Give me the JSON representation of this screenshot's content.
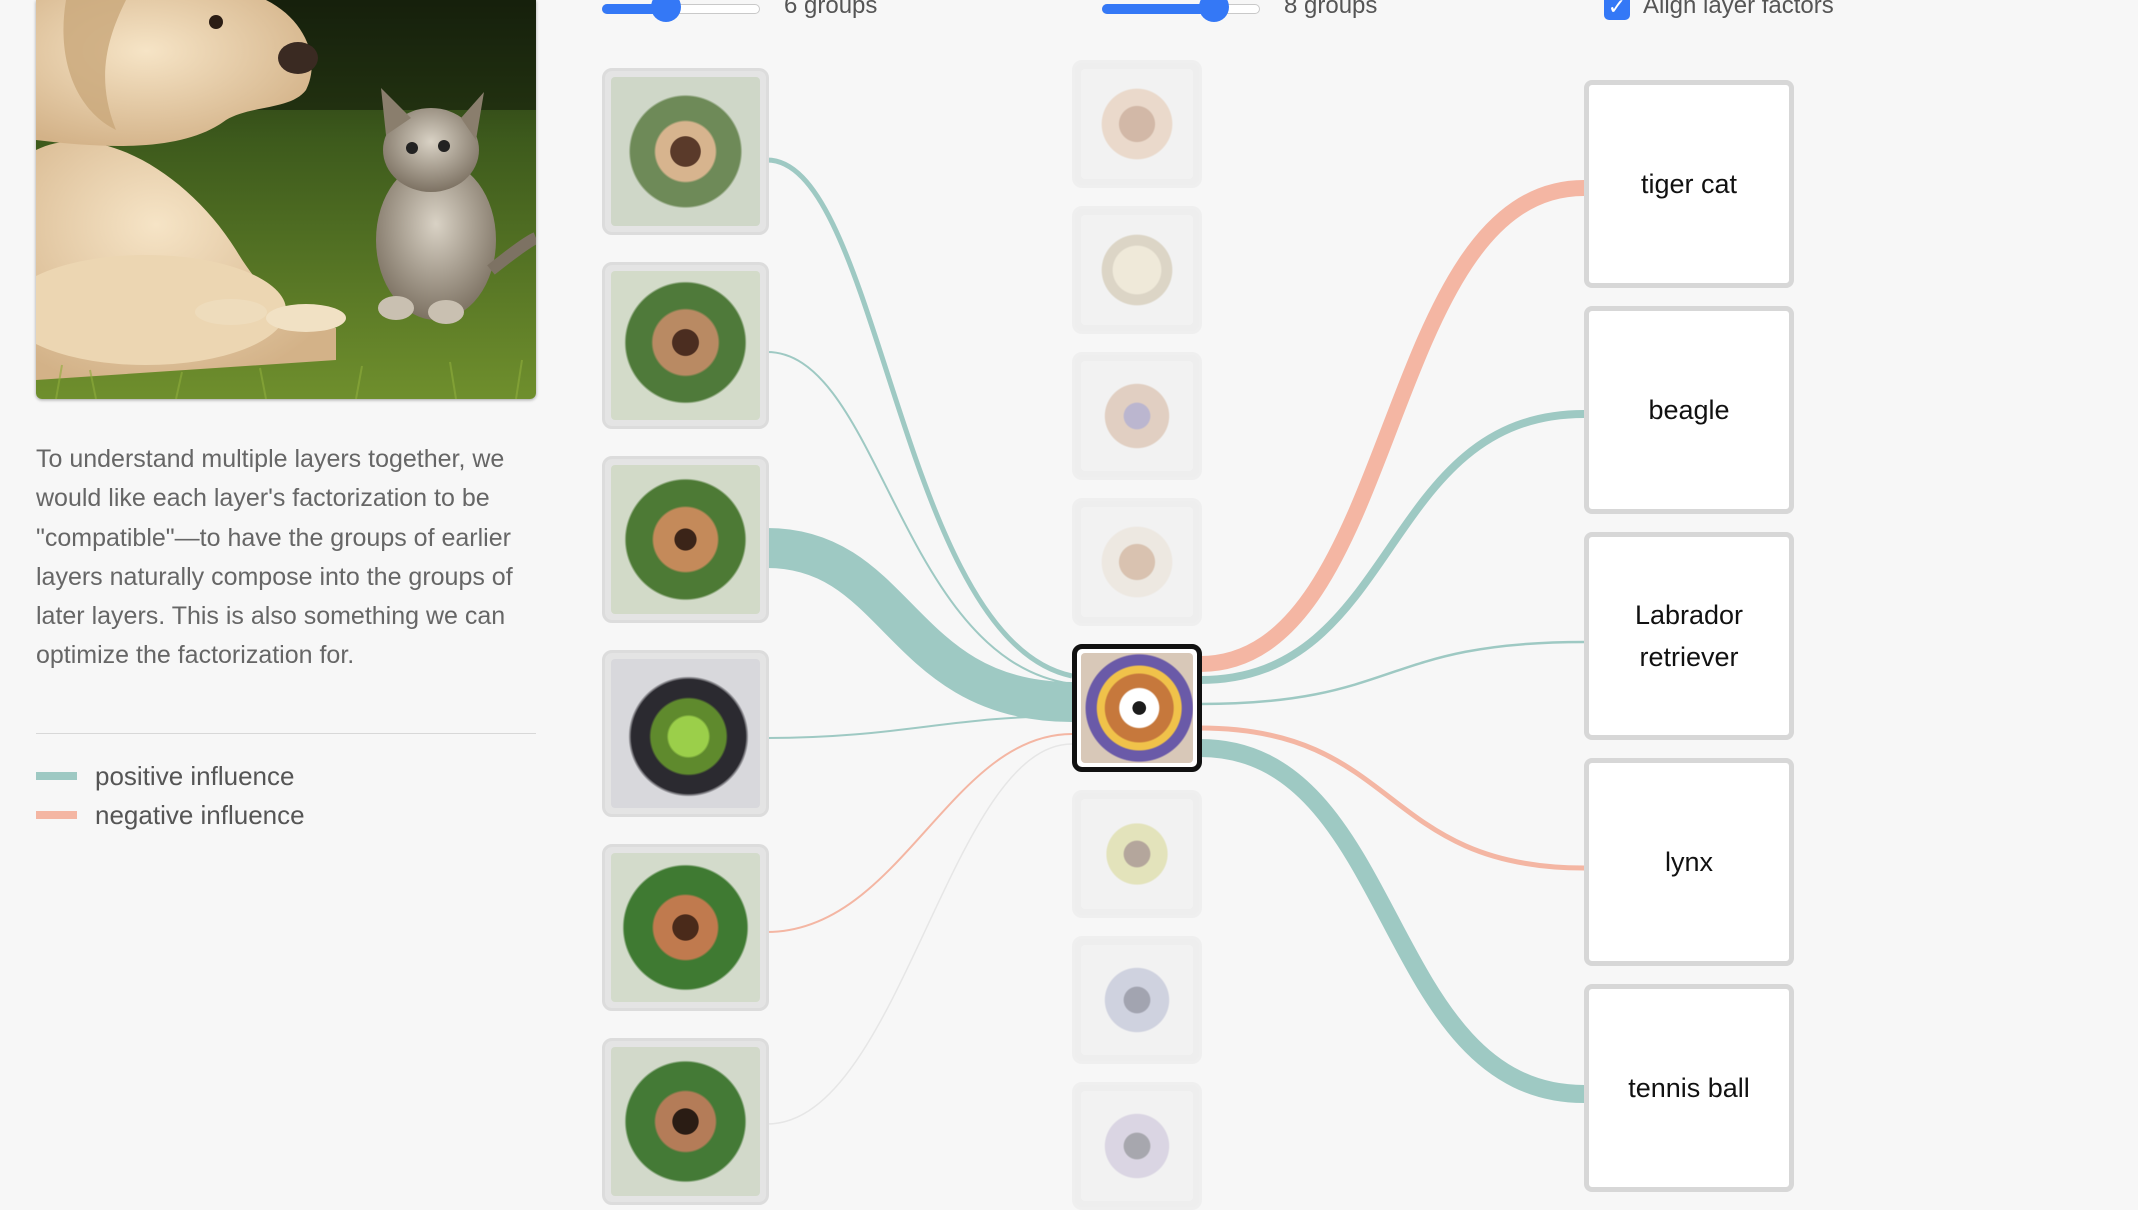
{
  "layer1_control": {
    "label": "6 groups",
    "value_fraction": 0.37
  },
  "layer2_control": {
    "label": "8 groups",
    "value_fraction": 0.71
  },
  "align_control": {
    "label": "Align layer factors",
    "checked": true
  },
  "caption": "To understand multiple layers together, we would like each layer's factorization to be \"compatible\"—to have the groups of earlier layers naturally compose into the groups of later layers. This is also something we can optimize the factorization for.",
  "legend": [
    {
      "label": "positive influence",
      "color": "#9ec9c3"
    },
    {
      "label": "negative influence",
      "color": "#f4b6a3"
    }
  ],
  "classes": [
    "tiger cat",
    "beagle",
    "Labrador retriever",
    "lynx",
    "tennis ball"
  ],
  "colors": {
    "positive": "#9ec9c3",
    "negative": "#f4b6a3",
    "accent": "#3478f6"
  },
  "layer1_groups": [
    {
      "influence": 0.18,
      "sign": "positive"
    },
    {
      "influence": 0.05,
      "sign": "positive"
    },
    {
      "influence": 1.0,
      "sign": "positive"
    },
    {
      "influence": 0.05,
      "sign": "positive"
    },
    {
      "influence": 0.05,
      "sign": "negative"
    },
    {
      "influence": 0.02,
      "sign": "positive"
    }
  ],
  "layer2_groups": {
    "count": 8,
    "selected_index": 4
  },
  "class_influences": [
    {
      "class": "tiger cat",
      "influence": 0.42,
      "sign": "negative"
    },
    {
      "class": "beagle",
      "influence": 0.2,
      "sign": "positive"
    },
    {
      "class": "Labrador retriever",
      "influence": 0.07,
      "sign": "positive"
    },
    {
      "class": "lynx",
      "influence": 0.13,
      "sign": "negative"
    },
    {
      "class": "tennis ball",
      "influence": 0.55,
      "sign": "positive"
    }
  ]
}
